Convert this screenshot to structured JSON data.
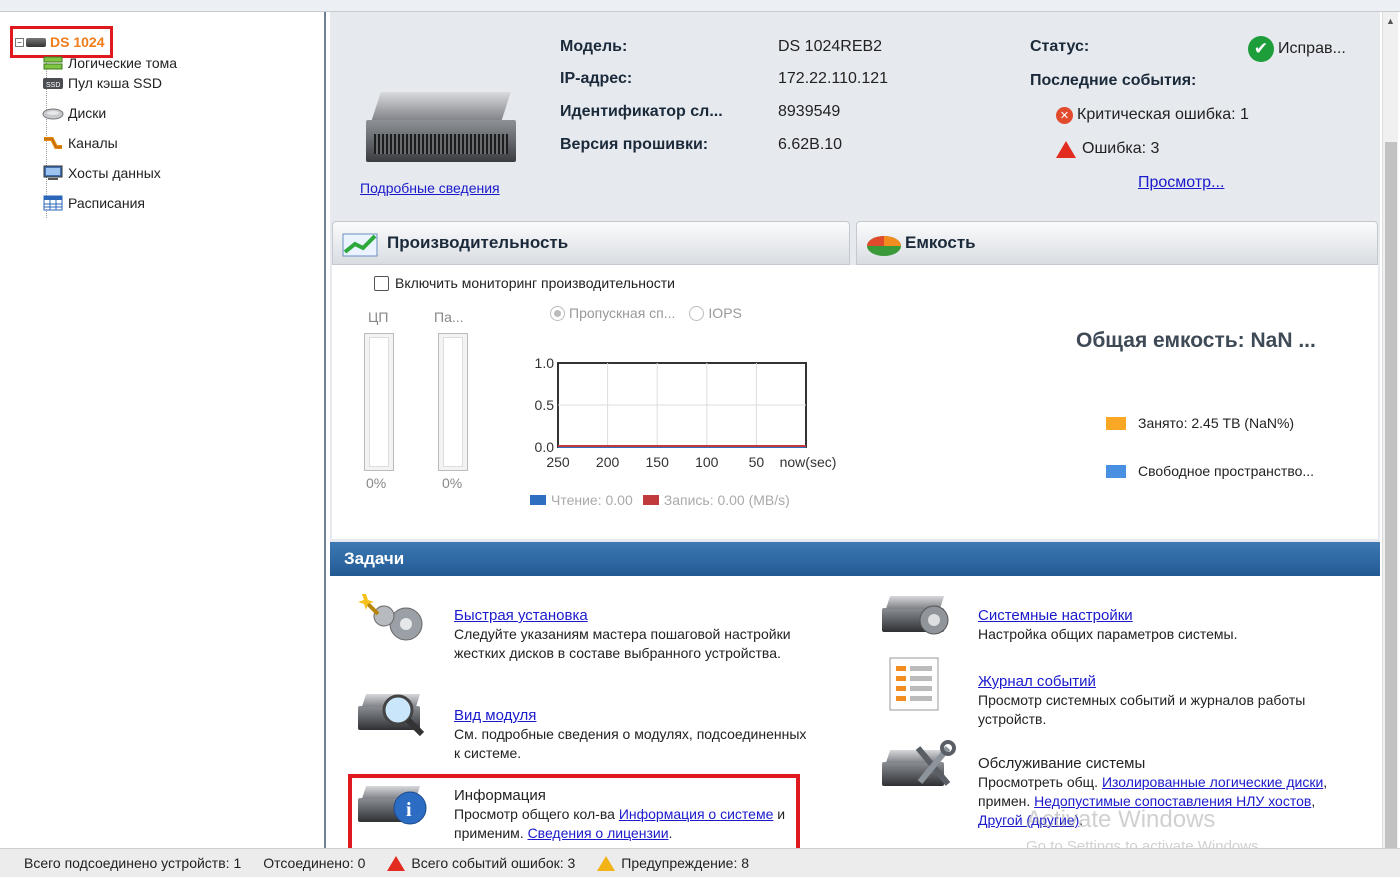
{
  "tree": {
    "root": "DS 1024",
    "items": [
      {
        "label": "Логические тома",
        "icon": "volumes-icon"
      },
      {
        "label": "Пул кэша SSD",
        "icon": "ssd-icon"
      },
      {
        "label": "Диски",
        "icon": "disk-icon"
      },
      {
        "label": "Каналы",
        "icon": "channels-icon"
      },
      {
        "label": "Хосты данных",
        "icon": "host-icon"
      },
      {
        "label": "Расписания",
        "icon": "schedule-icon"
      }
    ]
  },
  "device": {
    "details_link": "Подробные сведения",
    "model_label": "Модель:",
    "model_value": "DS 1024REB2",
    "ip_label": "IP-адрес:",
    "ip_value": "172.22.110.121",
    "id_label": "Идентификатор сл...",
    "id_value": "8939549",
    "fw_label": "Версия прошивки:",
    "fw_value": "6.62B.10",
    "status_label": "Статус:",
    "status_value": "Исправ...",
    "events_label": "Последние события:",
    "critical": "Критическая ошибка: 1",
    "errors": "Ошибка: 3",
    "view_link": "Просмотр..."
  },
  "performance": {
    "header": "Производительность",
    "monitor_checkbox": "Включить мониторинг производительности",
    "cpu_label": "ЦП",
    "mem_label": "Па...",
    "cpu_pct": "0%",
    "mem_pct": "0%",
    "radio_throughput": "Пропускная сп...",
    "radio_iops": "IOPS",
    "legend_read": "Чтение: 0.00",
    "legend_write": "Запись: 0.00 (MB/s)"
  },
  "chart_data": {
    "type": "line",
    "x": [
      250,
      200,
      150,
      100,
      50,
      "now(sec)"
    ],
    "x_ticks": [
      "250",
      "200",
      "150",
      "100",
      "50",
      "now(sec)"
    ],
    "y_ticks": [
      "1.0",
      "0.5",
      "0.0"
    ],
    "ylim": [
      0,
      1
    ],
    "series": [
      {
        "name": "Чтение",
        "color": "#2e6fc0",
        "values": [
          0,
          0,
          0,
          0,
          0,
          0
        ]
      },
      {
        "name": "Запись",
        "color": "#c0393b",
        "values": [
          0,
          0,
          0,
          0,
          0,
          0
        ]
      }
    ],
    "grid": true
  },
  "capacity": {
    "header": "Емкость",
    "total": "Общая емкость: NaN ...",
    "used": "Занято: 2.45 TB (NaN%)",
    "free": "Свободное пространство...",
    "used_color": "#f9a825",
    "free_color": "#4a90e2"
  },
  "tasks": {
    "header": "Задачи",
    "quick_setup_title": "Быстрая установка",
    "quick_setup_desc": "Следуйте указаниям мастера пошаговой настройки жестких дисков в составе выбранного устройства.",
    "module_view_title": "Вид модуля",
    "module_view_desc": "См. подробные сведения о модулях, подсоединенных к системе.",
    "info_title": "Информация",
    "info_desc_1": "Просмотр общего кол-ва ",
    "info_link_1": "Информация о системе",
    "info_desc_2": " и применим. ",
    "info_link_2": "Сведения о лицензии",
    "info_desc_3": ".",
    "sys_settings_title": "Системные настройки",
    "sys_settings_desc": "Настройка общих параметров системы.",
    "event_log_title": "Журнал событий",
    "event_log_desc": "Просмотр системных событий и журналов работы устройств.",
    "maint_title": "Обслуживание системы",
    "maint_desc_1": "Просмотреть общ. ",
    "maint_link_1": "Изолированные логические диски",
    "maint_desc_2": ", примен. ",
    "maint_link_2": "Недопустимые сопоставления НЛУ хостов",
    "maint_desc_3": ", ",
    "maint_link_3": "Другой (другие)",
    "maint_desc_4": "."
  },
  "statusbar": {
    "connected": "Всего подсоединено устройств: 1",
    "disconnected": "Отсоединено: 0",
    "errors": "Всего событий ошибок: 3",
    "warnings": "Предупреждение: 8"
  },
  "watermark": {
    "line1": "Activate Windows",
    "line2": "Go to Settings to activate Windows."
  }
}
